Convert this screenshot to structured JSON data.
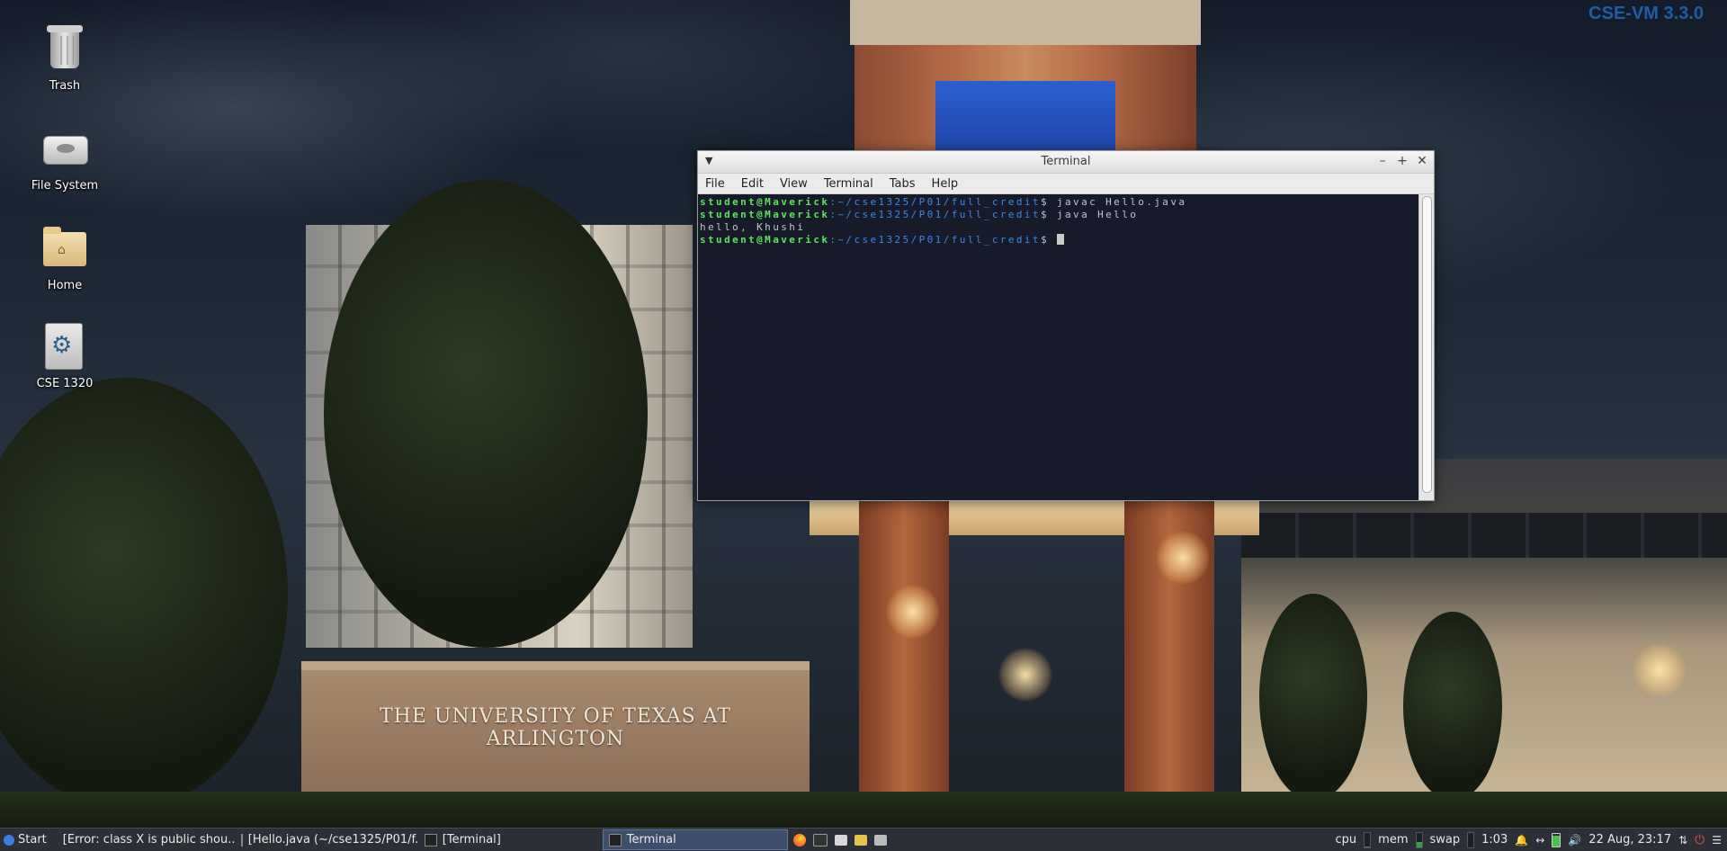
{
  "desktop": {
    "version_badge": "CSE-VM 3.3.0",
    "wallpaper_sign": "THE UNIVERSITY OF TEXAS AT ARLINGTON",
    "icons": [
      {
        "label": "Trash",
        "icon": "trash-icon"
      },
      {
        "label": "File System",
        "icon": "drive-icon"
      },
      {
        "label": "Home",
        "icon": "home-folder-icon"
      },
      {
        "label": "CSE 1320",
        "icon": "settings-launcher-icon"
      }
    ]
  },
  "terminal": {
    "title": "Terminal",
    "menu": [
      "File",
      "Edit",
      "View",
      "Terminal",
      "Tabs",
      "Help"
    ],
    "lines": [
      {
        "user": "student@Maverick",
        "path": ":~/cse1325/P01/full_credit",
        "cmd": "$ javac Hello.java"
      },
      {
        "user": "student@Maverick",
        "path": ":~/cse1325/P01/full_credit",
        "cmd": "$ java Hello"
      },
      {
        "output": "hello, Khushi"
      },
      {
        "user": "student@Maverick",
        "path": ":~/cse1325/P01/full_credit",
        "cmd": "$ "
      }
    ]
  },
  "taskbar": {
    "start_label": "Start",
    "tasks": [
      {
        "label": "[Error: class X is public shou...",
        "icon": "firefox-icon"
      },
      {
        "label": "[Hello.java (~/cse1325/P01/f...",
        "icon": "text-editor-icon"
      },
      {
        "label": "[Terminal]",
        "icon": "terminal-icon"
      },
      {
        "label": "Terminal",
        "icon": "terminal-icon",
        "active": true
      }
    ],
    "tray": {
      "cpu_label": "cpu",
      "mem_label": "mem",
      "swap_label": "swap",
      "uptime": "1:03",
      "datetime": "22 Aug, 23:17",
      "cpu_level": 0.05,
      "mem_level": 0.35,
      "swap_level": 0.0,
      "battery_level": 0.85
    }
  },
  "colors": {
    "prompt_user": "#5ee35e",
    "prompt_path": "#3f86e6",
    "terminal_bg": "#171b29",
    "taskbar_bg": "#2c3036",
    "version_badge": "#1e5ea8"
  }
}
